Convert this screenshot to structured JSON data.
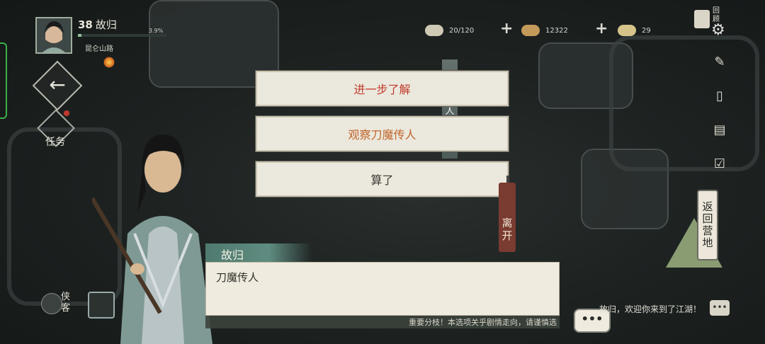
{
  "player": {
    "level": "38",
    "name": "故归",
    "exp_percent": "3.9%",
    "location": "昆仑山路"
  },
  "resources": [
    {
      "icon": "rice-icon",
      "value": "20/120"
    },
    {
      "icon": "bread-icon",
      "value": "12322"
    },
    {
      "icon": "silver-ingot-icon",
      "value": "29"
    }
  ],
  "top_right": {
    "review_label_1": "回",
    "review_label_2": "顾"
  },
  "left_nav": {
    "task_label": "任务"
  },
  "options": {
    "learn_more": "进一步了解",
    "observe": "观察刀魔传人",
    "forget_it": "算了"
  },
  "map": {
    "leave_1": "离",
    "leave_2": "开",
    "statue_char": "人",
    "camp_1": "返",
    "camp_2": "回",
    "camp_3": "营",
    "camp_4": "地"
  },
  "dialog": {
    "speaker": "故归",
    "text": "刀魔传人",
    "warning": "重要分枝！本选项关乎剧情走向，请谨慎选"
  },
  "chat": {
    "button": "•••",
    "message": "故归，欢迎你来到了江湖！",
    "icon_text": "•••"
  },
  "bottom_left": {
    "xiake_1": "侠",
    "xiake_2": "客"
  },
  "colors": {
    "option_red": "#c0392b",
    "option_orange": "#c0642a",
    "option_dark": "#3a3a34",
    "panel": "#ebe8dd"
  }
}
